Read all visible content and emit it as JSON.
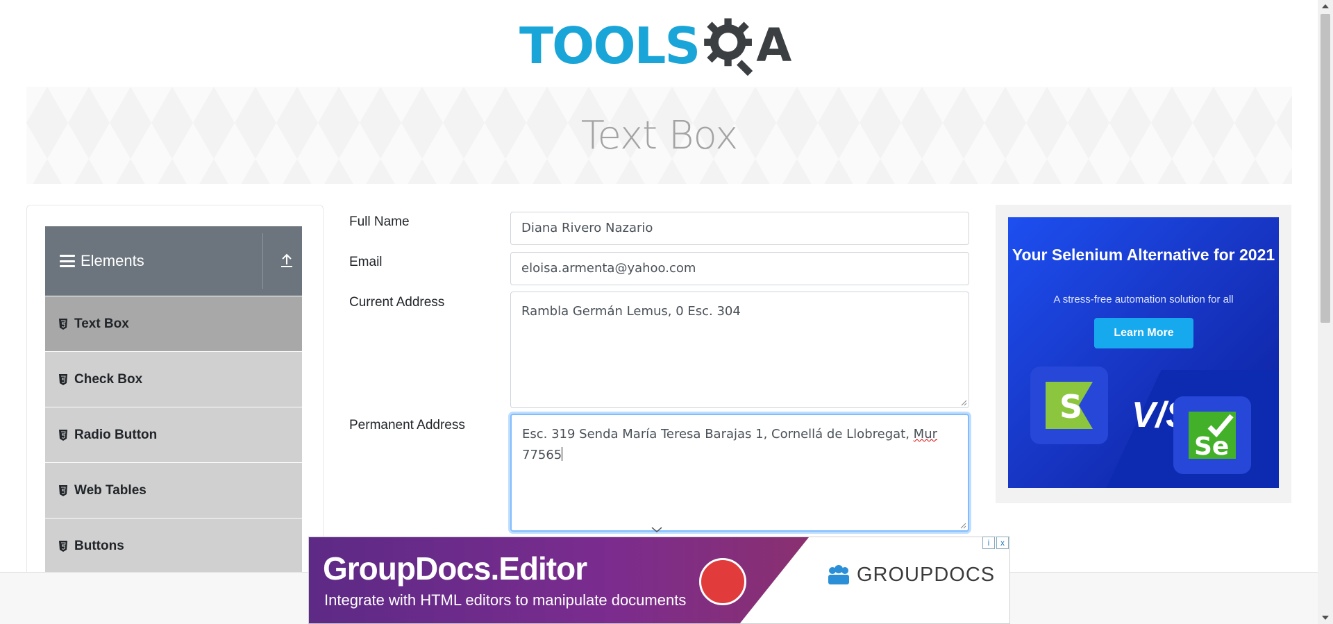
{
  "logo": {
    "text_tools": "TOOLS",
    "text_a": "A",
    "colors": {
      "tools": "#1aa5d8",
      "gear": "#3b3f42"
    }
  },
  "banner": {
    "title": "Text Box"
  },
  "sidebar": {
    "group_title": "Elements",
    "items": [
      {
        "label": "Text Box",
        "active": true
      },
      {
        "label": "Check Box",
        "active": false
      },
      {
        "label": "Radio Button",
        "active": false
      },
      {
        "label": "Web Tables",
        "active": false
      },
      {
        "label": "Buttons",
        "active": false
      }
    ]
  },
  "form": {
    "full_name": {
      "label": "Full Name",
      "value": "Diana Rivero Nazario"
    },
    "email": {
      "label": "Email",
      "value": "eloisa.armenta@yahoo.com"
    },
    "current_address": {
      "label": "Current Address",
      "value": "Rambla Germán Lemus, 0 Esc. 304"
    },
    "permanent_address": {
      "label": "Permanent Address",
      "value_line1_a": "Esc. 319 Senda María Teresa Barajas 1, Cornellá de Llobregat,",
      "value_line1_b": "Mur",
      "value_line2": "77565"
    }
  },
  "side_ad": {
    "headline": "Your Selenium Alternative for 2021",
    "subtitle": "A stress-free automation solution for all",
    "button": "Learn More",
    "vs": "V/S",
    "s_logo": "S",
    "se_logo": "Se"
  },
  "bottom_ad": {
    "title": "GroupDocs.Editor",
    "tagline": "Integrate with HTML editors to manipulate documents",
    "brand": "GROUPDOCS",
    "info": "i",
    "close": "x"
  }
}
